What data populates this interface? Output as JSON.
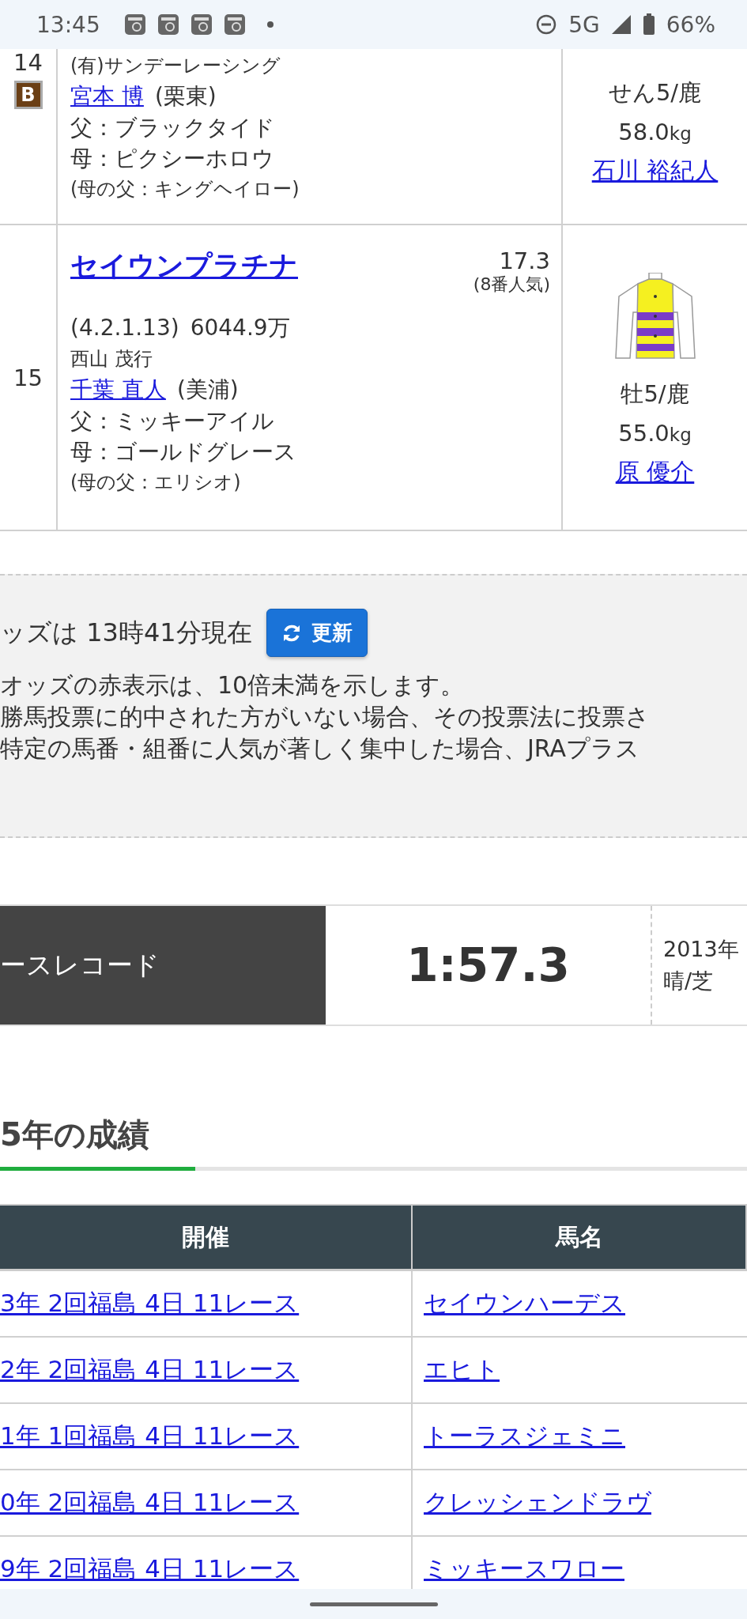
{
  "status_bar": {
    "time": "13:45",
    "network": "5G",
    "battery": "66%"
  },
  "horses": [
    {
      "number": "14",
      "blinker": "B",
      "owner": "(有)サンデーレーシング",
      "trainer": "宮本 博",
      "stable": "(栗東)",
      "sire": "父：ブラックタイド",
      "dam": "母：ピクシーホロウ",
      "damsire": "(母の父：キングヘイロー)",
      "sex_age": "せん5/鹿",
      "weight": "58.0",
      "unit": "kg",
      "jockey": "石川 裕紀人",
      "silks": false
    },
    {
      "number": "15",
      "name": "セイウンプラチナ",
      "odds": "17.3",
      "popularity": "(8番人気)",
      "record": "(4.2.1.13)",
      "earnings": "6044.9万",
      "owner": "西山 茂行",
      "trainer": "千葉 直人",
      "stable": "(美浦)",
      "sire": "父：ミッキーアイル",
      "dam": "母：ゴールドグレース",
      "damsire": "(母の父：エリシオ)",
      "sex_age": "牡5/鹿",
      "weight": "55.0",
      "unit": "kg",
      "jockey": "原 優介",
      "silks": true
    }
  ],
  "odds_info": {
    "time_text": "ッズは 13時41分現在",
    "refresh_button": "更新",
    "notes": [
      "オッズの赤表示は、10倍未満を示します。",
      "勝馬投票に的中された方がいない場合、その投票法に投票さ",
      "特定の馬番・組番に人気が著しく集中した場合、JRAプラス"
    ]
  },
  "course_record": {
    "label": "ースレコード",
    "time": "1:57.3",
    "date": "2013年",
    "condition": "晴/芝"
  },
  "past_results": {
    "heading": "5年の成績",
    "columns": [
      "開催",
      "馬名"
    ],
    "rows": [
      {
        "meeting": "3年 2回福島 4日 11レース",
        "horse": "セイウンハーデス"
      },
      {
        "meeting": "2年 2回福島 4日 11レース",
        "horse": "エヒト"
      },
      {
        "meeting": "1年 1回福島 4日 11レース",
        "horse": "トーラスジェミニ"
      },
      {
        "meeting": "0年 2回福島 4日 11レース",
        "horse": "クレッシェンドラヴ"
      },
      {
        "meeting": "9年 2回福島 4日 11レース",
        "horse": "ミッキースワロー"
      }
    ]
  }
}
